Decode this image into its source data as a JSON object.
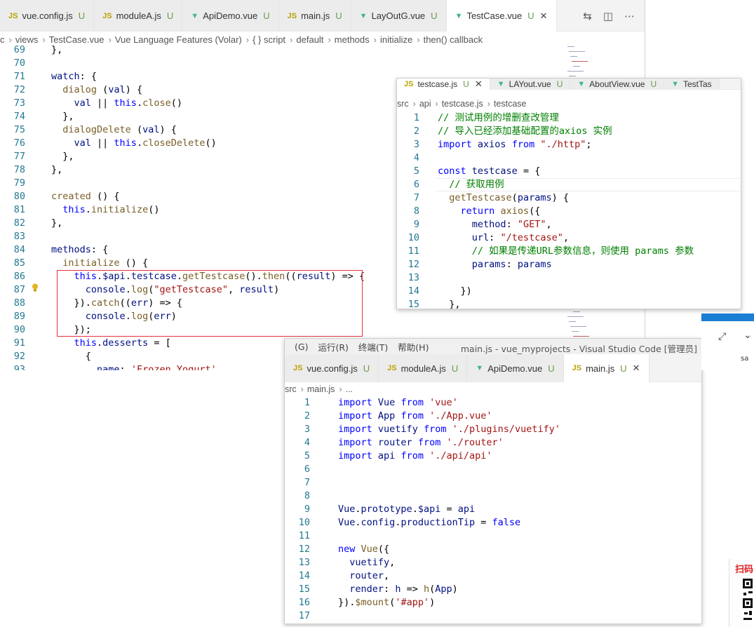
{
  "main_window": {
    "tabs": [
      {
        "icon": "JS",
        "label": "vue.config.js",
        "mark": "U",
        "active": false
      },
      {
        "icon": "JS",
        "label": "moduleA.js",
        "mark": "U",
        "active": false
      },
      {
        "icon": "V",
        "label": "ApiDemo.vue",
        "mark": "U",
        "active": false
      },
      {
        "icon": "JS",
        "label": "main.js",
        "mark": "U",
        "active": false
      },
      {
        "icon": "V",
        "label": "LayOutG.vue",
        "mark": "U",
        "active": false
      },
      {
        "icon": "V",
        "label": "TestCase.vue",
        "mark": "U",
        "active": true
      }
    ],
    "breadcrumb": [
      "c",
      "views",
      "TestCase.vue",
      "Vue Language Features (Volar)",
      "{ } script",
      "default",
      "methods",
      "initialize",
      "then() callback"
    ],
    "lines": [
      {
        "n": "69",
        "code": "},"
      },
      {
        "n": "70",
        "code": ""
      },
      {
        "n": "71",
        "code": "watch: {"
      },
      {
        "n": "72",
        "code": "  dialog (val) {"
      },
      {
        "n": "73",
        "code": "    val || this.close()"
      },
      {
        "n": "74",
        "code": "  },"
      },
      {
        "n": "75",
        "code": "  dialogDelete (val) {"
      },
      {
        "n": "76",
        "code": "    val || this.closeDelete()"
      },
      {
        "n": "77",
        "code": "  },"
      },
      {
        "n": "78",
        "code": "},"
      },
      {
        "n": "79",
        "code": ""
      },
      {
        "n": "80",
        "code": "created () {"
      },
      {
        "n": "81",
        "code": "  this.initialize()"
      },
      {
        "n": "82",
        "code": "},"
      },
      {
        "n": "83",
        "code": ""
      },
      {
        "n": "84",
        "code": "methods: {"
      },
      {
        "n": "85",
        "code": "  initialize () {"
      },
      {
        "n": "86",
        "code": "    this.$api.testcase.getTestcase().then((result) => {"
      },
      {
        "n": "87",
        "code": "      console.log(\"getTestcase\", result)"
      },
      {
        "n": "88",
        "code": "    }).catch((err) => {"
      },
      {
        "n": "89",
        "code": "      console.log(err)"
      },
      {
        "n": "90",
        "code": "    });"
      },
      {
        "n": "91",
        "code": "    this.desserts = ["
      },
      {
        "n": "92",
        "code": "      {"
      },
      {
        "n": "93",
        "code": "        name: 'Frozen Yogurt',"
      }
    ]
  },
  "testcase_window": {
    "tabs": [
      {
        "icon": "JS",
        "label": "testcase.js",
        "mark": "U",
        "active": true
      },
      {
        "icon": "V",
        "label": "LAYout.vue",
        "mark": "U",
        "active": false
      },
      {
        "icon": "V",
        "label": "AboutView.vue",
        "mark": "U",
        "active": false
      },
      {
        "icon": "V",
        "label": "TestTas",
        "mark": "",
        "active": false
      }
    ],
    "breadcrumb": [
      "src",
      "api",
      "testcase.js",
      "testcase"
    ],
    "lines": [
      {
        "n": "1",
        "code": "// 测试用例的增删查改管理"
      },
      {
        "n": "2",
        "code": "// 导入已经添加基础配置的axios 实例"
      },
      {
        "n": "3",
        "code": "import axios from \"./http\";"
      },
      {
        "n": "4",
        "code": ""
      },
      {
        "n": "5",
        "code": "const testcase = {"
      },
      {
        "n": "6",
        "code": "  // 获取用例"
      },
      {
        "n": "7",
        "code": "  getTestcase(params) {"
      },
      {
        "n": "8",
        "code": "    return axios({"
      },
      {
        "n": "9",
        "code": "      method: \"GET\","
      },
      {
        "n": "10",
        "code": "      url: \"/testcase\","
      },
      {
        "n": "11",
        "code": "      // 如果是传递URL参数信息，则使用 params 参数"
      },
      {
        "n": "12",
        "code": "      params: params"
      },
      {
        "n": "13",
        "code": ""
      },
      {
        "n": "14",
        "code": "    })"
      },
      {
        "n": "15",
        "code": "  },"
      }
    ]
  },
  "mainjs_window": {
    "menu": [
      "(G)",
      "运行(R)",
      "终端(T)",
      "帮助(H)"
    ],
    "title": "main.js - vue_myprojects - Visual Studio Code [管理员]",
    "tabs": [
      {
        "icon": "JS",
        "label": "vue.config.js",
        "mark": "U",
        "active": false
      },
      {
        "icon": "JS",
        "label": "moduleA.js",
        "mark": "U",
        "active": false
      },
      {
        "icon": "V",
        "label": "ApiDemo.vue",
        "mark": "U",
        "active": false
      },
      {
        "icon": "JS",
        "label": "main.js",
        "mark": "U",
        "active": true
      }
    ],
    "breadcrumb": [
      "src",
      "main.js",
      "..."
    ],
    "lines": [
      {
        "n": "1",
        "code": "import Vue from 'vue'"
      },
      {
        "n": "2",
        "code": "import App from './App.vue'"
      },
      {
        "n": "3",
        "code": "import vuetify from './plugins/vuetify'"
      },
      {
        "n": "4",
        "code": "import router from './router'"
      },
      {
        "n": "5",
        "code": "import api from './api/api'"
      },
      {
        "n": "6",
        "code": ""
      },
      {
        "n": "7",
        "code": ""
      },
      {
        "n": "8",
        "code": ""
      },
      {
        "n": "9",
        "code": "Vue.prototype.$api = api"
      },
      {
        "n": "10",
        "code": "Vue.config.productionTip = false"
      },
      {
        "n": "11",
        "code": ""
      },
      {
        "n": "12",
        "code": "new Vue({"
      },
      {
        "n": "13",
        "code": "  vuetify,"
      },
      {
        "n": "14",
        "code": "  router,"
      },
      {
        "n": "15",
        "code": "  render: h => h(App)"
      },
      {
        "n": "16",
        "code": "}).$mount('#app')"
      },
      {
        "n": "17",
        "code": ""
      }
    ]
  },
  "qr_panel": {
    "label": "扫码"
  },
  "side_panel": {
    "text": "sa"
  },
  "colors": {
    "accent_blue": "#1a7fd4",
    "highlight_box": "#e5323a",
    "line_number": "#237893",
    "keyword": "#0000ff",
    "string": "#a31515",
    "comment": "#008000"
  }
}
